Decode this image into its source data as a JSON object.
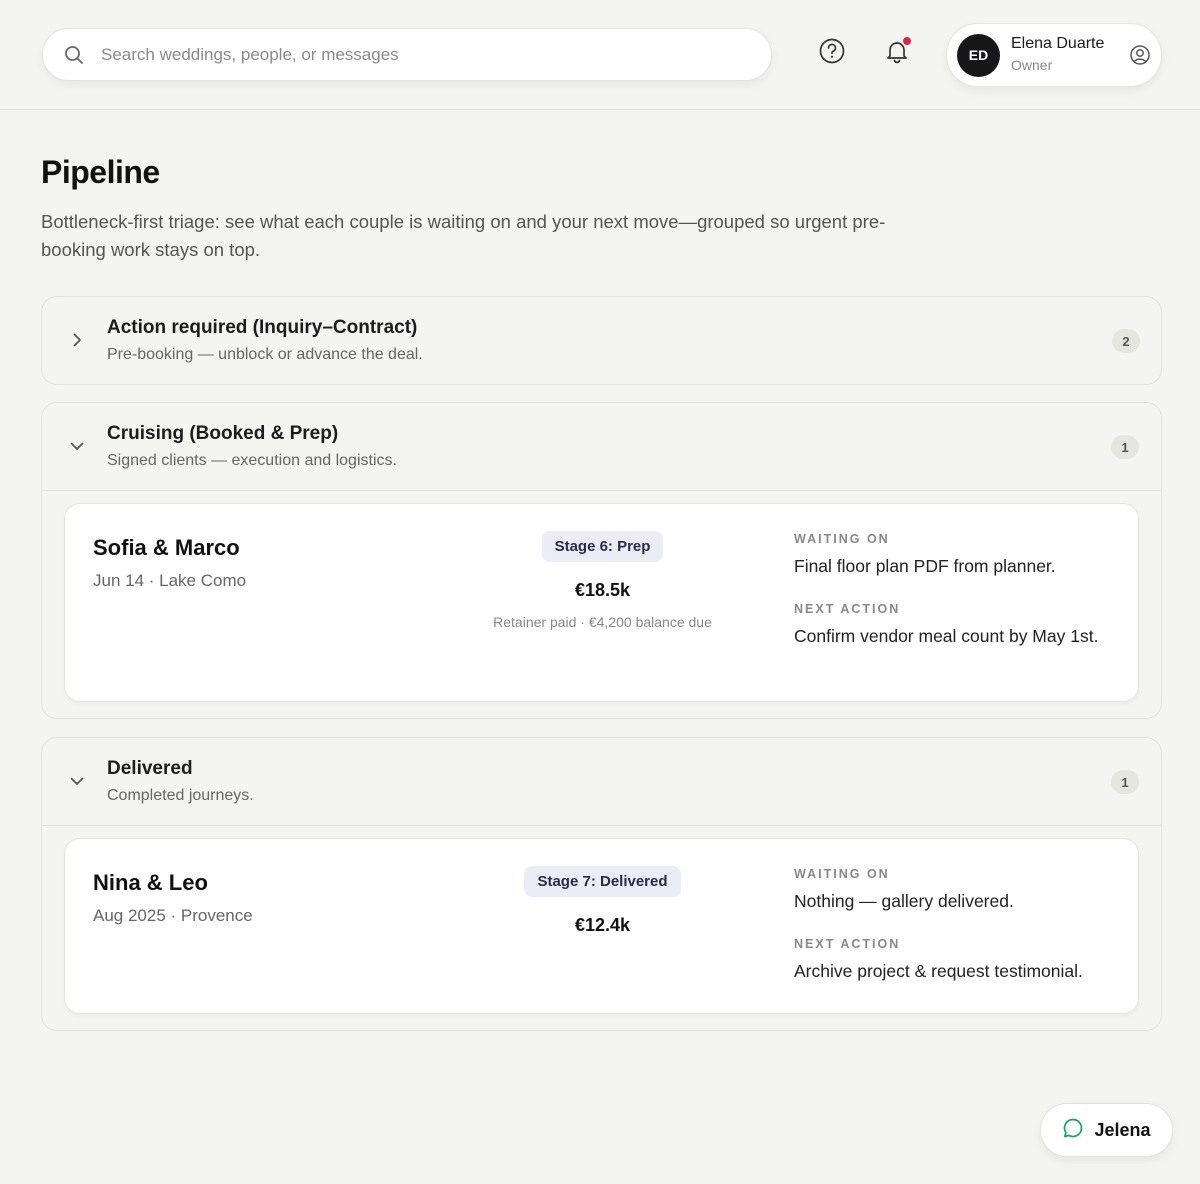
{
  "search": {
    "placeholder": "Search weddings, people, or messages"
  },
  "profile": {
    "initials": "ED",
    "name": "Elena Duarte",
    "role": "Owner"
  },
  "page": {
    "title": "Pipeline",
    "description": "Bottleneck-first triage: see what each couple is waiting on and your next move—grouped so urgent pre-booking work stays on top."
  },
  "groups": [
    {
      "title": "Action required (Inquiry–Contract)",
      "subtitle": "Pre-booking — unblock or advance the deal.",
      "count": "2",
      "expanded": false
    },
    {
      "title": "Cruising (Booked & Prep)",
      "subtitle": "Signed clients — execution and logistics.",
      "count": "1",
      "expanded": true,
      "cards": [
        {
          "couple": "Sofia & Marco",
          "meta": "Jun 14 · Lake Como",
          "stage": "Stage 6: Prep",
          "price": "€18.5k",
          "price_note": "Retainer paid · €4,200 balance due",
          "waiting_label": "WAITING ON",
          "waiting_on": "Final floor plan PDF from planner.",
          "next_label": "NEXT ACTION",
          "next_action": "Confirm vendor meal count by May 1st."
        }
      ]
    },
    {
      "title": "Delivered",
      "subtitle": "Completed journeys.",
      "count": "1",
      "expanded": true,
      "cards": [
        {
          "couple": "Nina & Leo",
          "meta": "Aug 2025 · Provence",
          "stage": "Stage 7: Delivered",
          "price": "€12.4k",
          "waiting_label": "WAITING ON",
          "waiting_on": "Nothing — gallery delivered.",
          "next_label": "NEXT ACTION",
          "next_action": "Archive project & request testimonial."
        }
      ]
    }
  ],
  "chat": {
    "label": "Jelena",
    "accent": "#1aa35a"
  },
  "colors": {
    "notification_dot": "#e0254a",
    "avatar_bg": "#17171a",
    "badge_bg": "#ececf7"
  }
}
